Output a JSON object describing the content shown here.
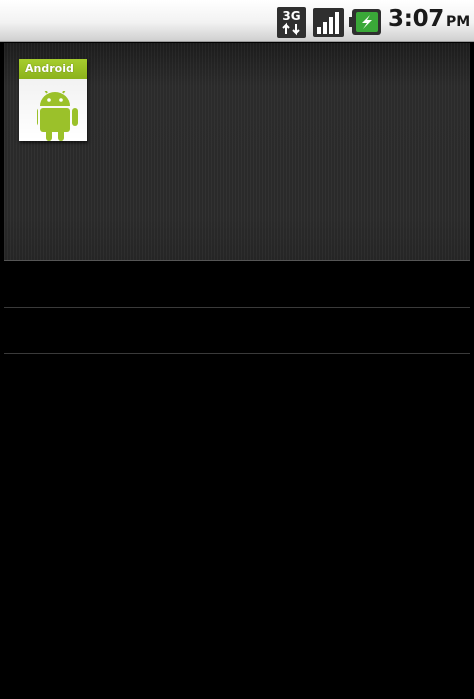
{
  "status_bar": {
    "network_type": "3G",
    "network_icon": "3g-data-arrows-icon",
    "signal_icon": "signal-strength-icon",
    "battery_icon": "battery-charging-icon",
    "time": "3:07",
    "ampm": "PM"
  },
  "file_tile": {
    "label": "Android",
    "icon": "android-robot-icon",
    "accent_color": "#9bc12a"
  }
}
